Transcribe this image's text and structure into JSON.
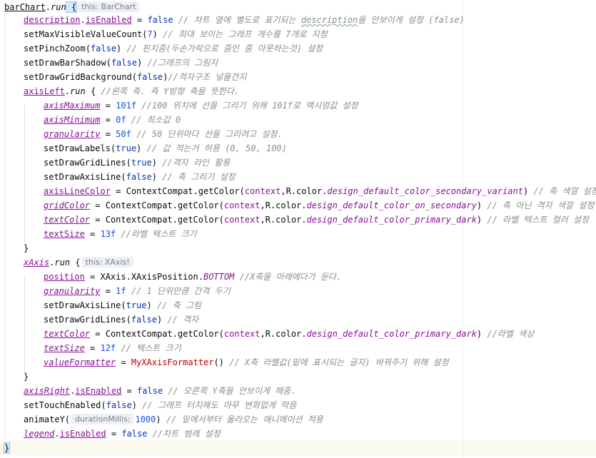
{
  "editor": {
    "hints": {
      "barchart_this": "this: BarChart",
      "xaxis_this": "this: XAxis!",
      "duration_param": "durationMillis:"
    },
    "lines": {
      "l1_obj": "barChart",
      "l1_dot": ".",
      "l1_run": "run",
      "l1_brace": " {",
      "l2_desc": "description",
      "l2_dot": ".",
      "l2_prop": "isEnabled",
      "l2_eq": " = ",
      "l2_val": "false",
      "l2_comment_a": " // 차트 옆에 별도로 표기되는 ",
      "l2_comment_b": "description",
      "l2_comment_c": "을 안보이게 설정 (false)",
      "l3_fn": "setMaxVisibleValueCount(",
      "l3_num": "7",
      "l3_close": ")",
      "l3_comment": " // 최대 보이는 그래프 개수를 7개로 지정",
      "l4_fn": "setPinchZoom(",
      "l4_val": "false",
      "l4_close": ")",
      "l4_comment": " // 핀치줌(두손가락으로 줌인 줌 아웃하는것) 설정",
      "l5_fn": "setDrawBarShadow(",
      "l5_val": "false",
      "l5_close": ")",
      "l5_comment": " //그래프의 그림자",
      "l6_fn": "setDrawGridBackground(",
      "l6_val": "false",
      "l6_close": ")",
      "l6_comment": "//격자구조 넣을건지",
      "l7_obj": "axisLeft",
      "l7_dot": ".",
      "l7_run": "run",
      "l7_brace": " { ",
      "l7_comment": "//왼쪽 축. 즉 Y방향 축을 뜻한다.",
      "l8_prop": "axisMaximum",
      "l8_eq": " = ",
      "l8_num": "101f",
      "l8_comment": " //100 위치에 선을 그리기 위해 101f로 맥시멈값 설정",
      "l9_prop": "axisMinimum",
      "l9_eq": " = ",
      "l9_num": "0f",
      "l9_comment": " // 최소값 0",
      "l10_prop": "granularity",
      "l10_eq": " = ",
      "l10_num": "50f",
      "l10_comment": " // 50 단위마다 선을 그리려고 설정.",
      "l11_fn": "setDrawLabels(",
      "l11_val": "true",
      "l11_close": ")",
      "l11_comment": " // 값 적는거 허용 (0, 50, 100)",
      "l12_fn": "setDrawGridLines(",
      "l12_val": "true",
      "l12_close": ")",
      "l12_comment": " //격자 라인 활용",
      "l13_fn": "setDrawAxisLine(",
      "l13_val": "false",
      "l13_close": ")",
      "l13_comment": " // 축 그리기 설정",
      "l14_prop": "axisLineColor",
      "l14_eq": " = ",
      "l14_fn": "ContextCompat.getColor(",
      "l14_ctx": "context",
      "l14_rc": ",R.color.",
      "l14_res": "design_default_color_secondary_variant",
      "l14_close": ")",
      "l14_comment": " // 축 색깔 설정",
      "l15_prop": "gridColor",
      "l15_eq": " = ",
      "l15_fn": "ContextCompat.getColor(",
      "l15_ctx": "context",
      "l15_rc": ",R.color.",
      "l15_res": "design_default_color_on_secondary",
      "l15_close": ")",
      "l15_comment": " // 축 아닌 격자 색깔 설정",
      "l16_prop": "textColor",
      "l16_eq": " = ",
      "l16_fn": "ContextCompat.getColor(",
      "l16_ctx": "context",
      "l16_rc": ",R.color.",
      "l16_res": "design_default_color_primary_dark",
      "l16_close": ")",
      "l16_comment": " // 라벨 텍스트 컬러 설정",
      "l17_prop": "textSize",
      "l17_eq": " = ",
      "l17_num": "13f",
      "l17_comment": " //라벨 텍스트 크기",
      "l18_brace": "}",
      "l19_obj": "xAxis",
      "l19_dot": ".",
      "l19_run": "run",
      "l19_brace": " {",
      "l20_prop": "position",
      "l20_eq": " = ",
      "l20_cls": "XAxis.XAxisPosition.",
      "l20_const": "BOTTOM",
      "l20_comment": " //X축을 아래에다가 둔다.",
      "l21_prop": "granularity",
      "l21_eq": " = ",
      "l21_num": "1f",
      "l21_comment": " // 1 단위만큼 간격 두기",
      "l22_fn": "setDrawAxisLine(",
      "l22_val": "true",
      "l22_close": ")",
      "l22_comment": " // 축 그림",
      "l23_fn": "setDrawGridLines(",
      "l23_val": "false",
      "l23_close": ")",
      "l23_comment": " // 격자",
      "l24_prop": "textColor",
      "l24_eq": " = ",
      "l24_fn": "ContextCompat.getColor(",
      "l24_ctx": "context",
      "l24_rc": ",R.color.",
      "l24_res": "design_default_color_primary_dark",
      "l24_close": ")",
      "l24_comment": " //라벨 색상",
      "l25_prop": "textSize",
      "l25_eq": " = ",
      "l25_num": "12f",
      "l25_comment": " // 텍스트 크기",
      "l26_prop": "valueFormatter",
      "l26_eq": " = ",
      "l26_cls": "MyXAxisFormatter",
      "l26_close": "()",
      "l26_comment": " // X축 라벨값(밑에 표시되는 글자) 바꿔주기 위해 설정",
      "l27_brace": "}",
      "l28_obj": "axisRight",
      "l28_dot": ".",
      "l28_prop": "isEnabled",
      "l28_eq": " = ",
      "l28_val": "false",
      "l28_comment": " // 오른쪽 Y축을 안보이게 해줌.",
      "l29_fn": "setTouchEnabled(",
      "l29_val": "false",
      "l29_close": ")",
      "l29_comment": " // 그래프 터치해도 아무 변화없게 막음",
      "l30_fn": "animateY(",
      "l30_num": "1000",
      "l30_close": ")",
      "l30_comment": " // 밑에서부터 올라오는 애니메이션 적용",
      "l31_obj": "legend",
      "l31_dot": ".",
      "l31_prop": "isEnabled",
      "l31_eq": " = ",
      "l31_val": "false",
      "l31_comment": " //차트 범례 설정",
      "l32_brace": "}"
    }
  },
  "colors": {
    "keyword": "#0033b3",
    "number": "#1750eb",
    "property": "#871094",
    "comment": "#8c8c8c",
    "call": "#00627a",
    "class_red": "#c80000",
    "caret_line": "#fcfaed"
  }
}
